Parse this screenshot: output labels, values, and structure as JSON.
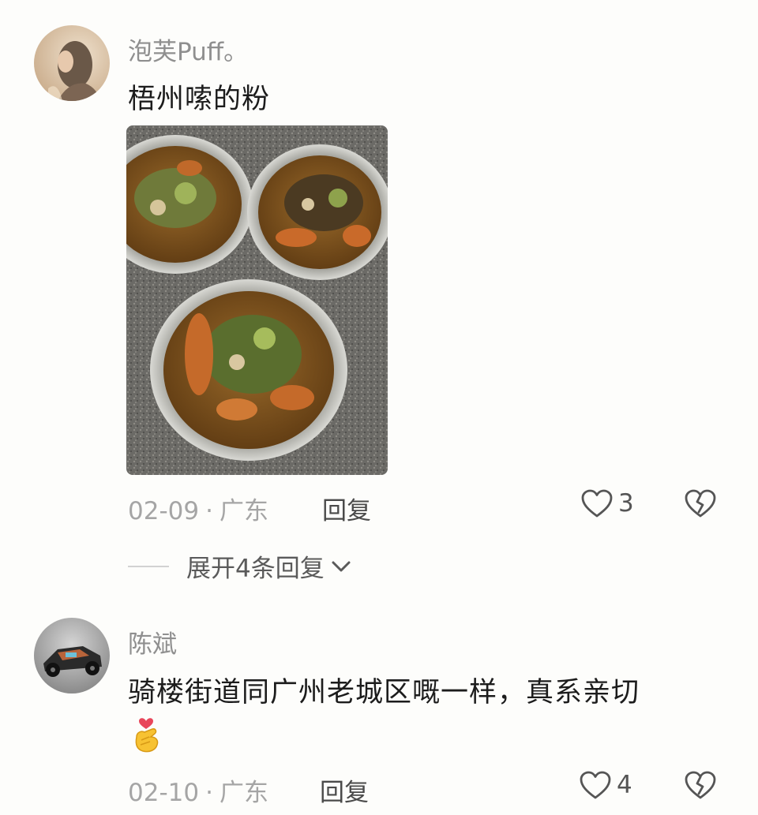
{
  "comments": [
    {
      "username": "泡芙Puff。",
      "text": "梧州嗦的粉",
      "date": "02-09",
      "separator": "·",
      "location": "广东",
      "reply_label": "回复",
      "likes": "3",
      "expand_label": "展开4条回复",
      "avatar_icon": "woman-portrait-avatar",
      "photo_icon": "noodle-bowls-photo"
    },
    {
      "username": "陈斌",
      "text": "骑楼街道同广州老城区嘅一样，真系亲切",
      "emoji": "finger-heart-emoji",
      "date": "02-10",
      "separator": "·",
      "location": "广东",
      "reply_label": "回复",
      "likes": "4",
      "avatar_icon": "toy-car-avatar"
    }
  ],
  "colors": {
    "background": "#fdfdfb",
    "username": "#8f8f8f",
    "meta": "#a5a5a5",
    "text": "#1c1c1c"
  }
}
